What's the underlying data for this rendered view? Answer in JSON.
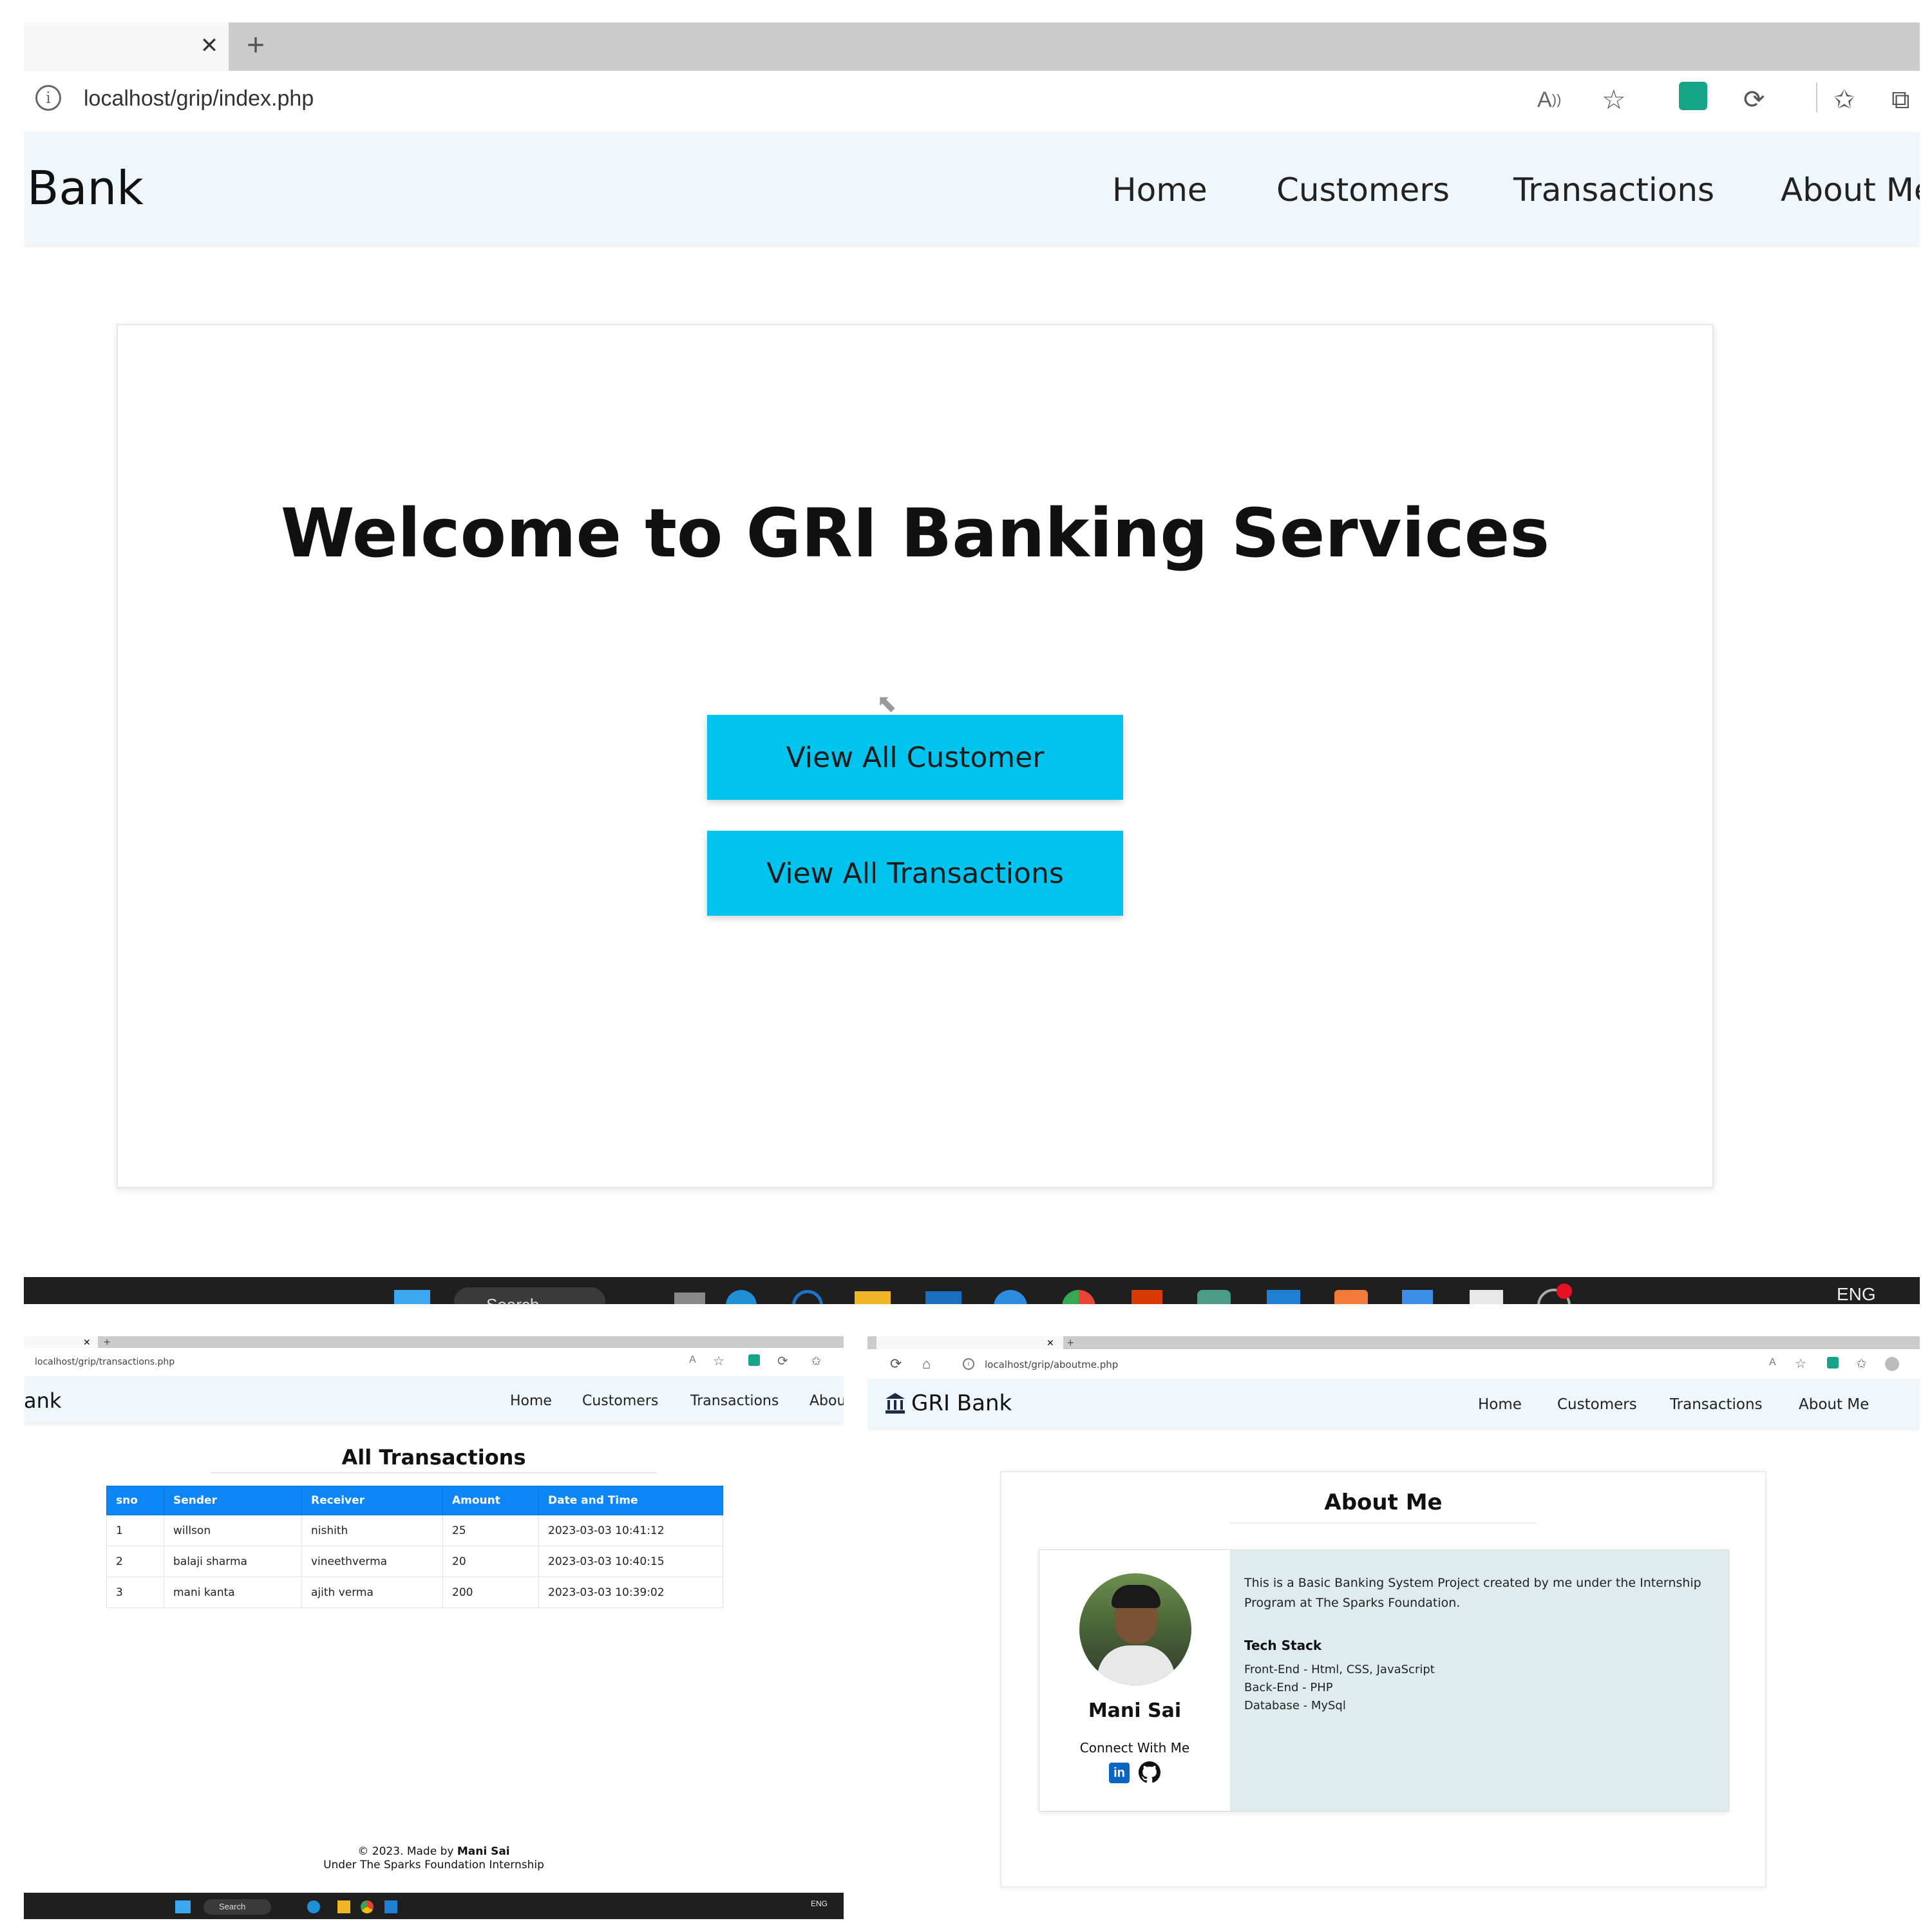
{
  "main_window": {
    "address_url": "localhost/grip/index.php",
    "brand_partial": "Bank",
    "nav": [
      "Home",
      "Customers",
      "Transactions",
      "About Me"
    ],
    "welcome_title": "Welcome to GRI Banking Services",
    "btn_customers": "View All Customer",
    "btn_transactions": "View All Transactions",
    "taskbar_search": "Search",
    "taskbar_lang": "ENG"
  },
  "transactions_window": {
    "address_url": "localhost/grip/transactions.php",
    "brand_partial": "ank",
    "nav": [
      "Home",
      "Customers",
      "Transactions",
      "Abou"
    ],
    "page_title": "All Transactions",
    "table": {
      "headers": [
        "sno",
        "Sender",
        "Receiver",
        "Amount",
        "Date and Time"
      ],
      "rows": [
        [
          "1",
          "willson",
          "nishith",
          "25",
          "2023-03-03 10:41:12"
        ],
        [
          "2",
          "balaji sharma",
          "vineethverma",
          "20",
          "2023-03-03 10:40:15"
        ],
        [
          "3",
          "mani kanta",
          "ajith verma",
          "200",
          "2023-03-03 10:39:02"
        ]
      ]
    },
    "footer_line1_prefix": "© 2023. Made by",
    "footer_author": "Mani Sai",
    "footer_line2": "Under The Sparks Foundation Internship",
    "taskbar_search": "Search",
    "taskbar_lang": "ENG"
  },
  "about_window": {
    "address_url": "localhost/grip/aboutme.php",
    "brand": "GRI Bank",
    "nav": [
      "Home",
      "Customers",
      "Transactions",
      "About Me"
    ],
    "page_title": "About Me",
    "name": "Mani Sai",
    "connect_label": "Connect With Me",
    "description": "This is a Basic Banking System Project created by me under the Internship Program at The Sparks Foundation.",
    "tech_title": "Tech Stack",
    "tech_items": [
      "Front-End - Html, CSS, JavaScript",
      "Back-End - PHP",
      "Database - MySql"
    ]
  },
  "colors": {
    "accent_button": "#00c4ee",
    "table_header": "#0d86f5",
    "navbar_bg": "#f0f7fc",
    "info_box_bg": "#deecef",
    "taskbar_bg": "#1f1f1f"
  },
  "icons": [
    "close-icon",
    "plus-icon",
    "info-icon",
    "read-aloud-icon",
    "favorite-add-icon",
    "extension-icon",
    "favorites-icon",
    "collections-icon",
    "refresh-icon",
    "home-icon",
    "bank-icon",
    "linkedin-icon",
    "github-icon",
    "mouse-cursor-icon"
  ]
}
